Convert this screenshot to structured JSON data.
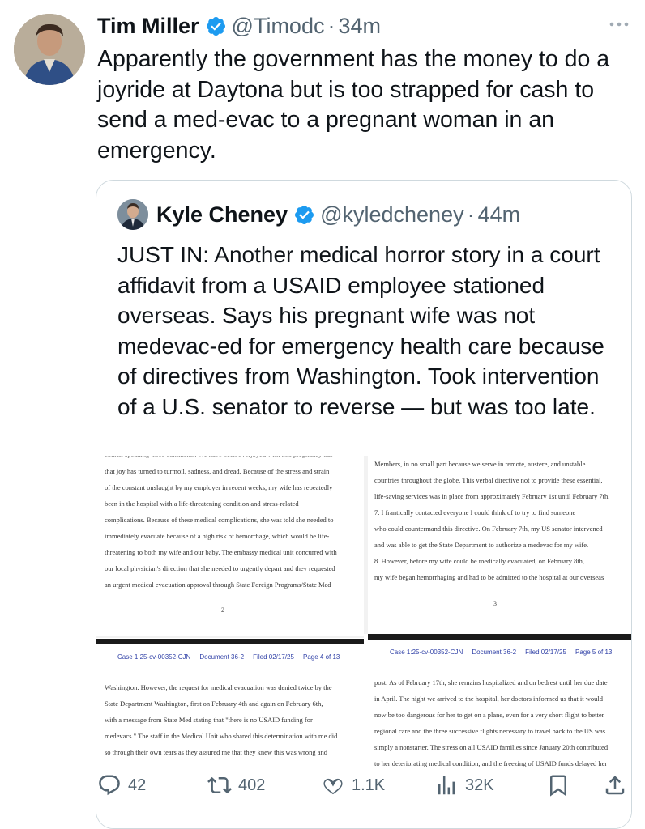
{
  "tweet": {
    "author_name": "Tim Miller",
    "handle": "@Timodc",
    "separator": "·",
    "time": "34m",
    "text": "Apparently the government has the money to do a joyride at Daytona but is too strapped for cash to send a med-evac to a pregnant woman in an emergency."
  },
  "quote": {
    "author_name": "Kyle Cheney",
    "handle": "@kyledcheney",
    "separator": "·",
    "time": "44m",
    "text": "JUST IN: Another medical horror story in a court affidavit from a USAID employee stationed overseas. Says his pregnant wife was not medevac-ed for emergency health care because of directives from Washington. Took intervention of a U.S. senator to reverse — but was too late."
  },
  "document": {
    "page_tl": {
      "lines": [
        "that joy has turned to turmoil, sadness, and dread. Because of the stress and strain",
        "of the constant onslaught by my employer in recent weeks, my wife has repeatedly",
        "been in the hospital with a life-threatening condition and stress-related",
        "complications. Because of these medical complications, she was told she needed to",
        "immediately evacuate because of a high risk of hemorrhage, which would be life-",
        "threatening to both my wife and our baby. The embassy medical unit concurred with",
        "our local physician's direction that she needed to urgently depart and they requested",
        "an urgent medical evacuation approval through State Foreign Programs/State Med"
      ],
      "page_number": "2"
    },
    "page_tr": {
      "lines": [
        "Members, in no small part because we serve in remote, austere, and unstable",
        "countries throughout the globe. This verbal directive not to provide these essential,",
        "life-saving services was in place from approximately February 1st until February 7th.",
        "7.      I frantically contacted everyone I could think of to try to find someone",
        "who could countermand this directive. On February 7th, my US senator intervened",
        "and was able to get the State Department to authorize a medevac for my wife.",
        "8.      However, before my wife could be medically evacuated, on February 8th,",
        "my wife began hemorrhaging and had to be admitted to the hospital at our overseas"
      ],
      "page_number": "3"
    },
    "header_left": "Case 1:25-cv-00352-CJN     Document 36-2     Filed 02/17/25     Page 4 of 13",
    "header_right": "Case 1:25-cv-00352-CJN     Document 36-2     Filed 02/17/25     Page 5 of 13",
    "page_bl": {
      "lines": [
        "Washington. However, the request for medical evacuation was denied twice by the",
        "State Department Washington, first on February 4th and again on February 6th,",
        "with a message from State Med stating that \"there is no USAID funding for",
        "medevacs.\" The staff in the Medical Unit who shared this determination with me did",
        "so through their own tears as they assured me that they knew this was wrong and"
      ]
    },
    "page_br": {
      "lines": [
        "post. As of February 17th, she remains hospitalized and on bedrest until her due date",
        "in April. The night we arrived to the hospital, her doctors informed us that it would",
        "now be too dangerous for her to get on a plane, even for a very short flight to better",
        "regional care and the three successive flights necessary to travel back to the US was",
        "simply a nonstarter. The stress on all USAID families since January 20th contributed",
        "to her deteriorating medical condition, and the freezing of USAID funds delayed her"
      ]
    }
  },
  "actions": {
    "replies": "42",
    "reposts": "402",
    "likes": "1.1K",
    "views": "32K"
  },
  "colors": {
    "verified": "#1d9bf0",
    "muted": "#536471",
    "text": "#0f1419",
    "doc_link": "#2e3fa6"
  },
  "icons": [
    "more-icon",
    "verified-badge-icon",
    "reply-icon",
    "repost-icon",
    "like-icon",
    "views-icon",
    "bookmark-icon",
    "share-icon"
  ]
}
